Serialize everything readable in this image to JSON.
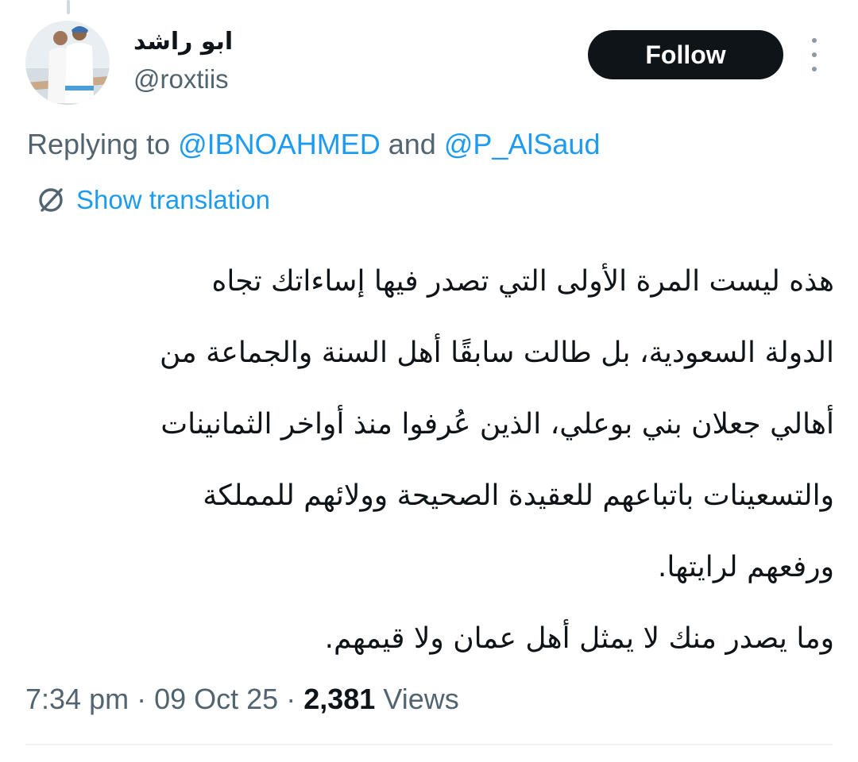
{
  "user": {
    "display_name": "ابو راشد",
    "handle": "@roxtiis"
  },
  "actions": {
    "follow_label": "Follow",
    "more_icon": "more-vertical-icon"
  },
  "reply": {
    "prefix": "Replying to",
    "mention_1": "@IBNOAHMED",
    "conjunction": "and",
    "mention_2": "@P_AlSaud"
  },
  "translation": {
    "label": "Show translation",
    "icon": "translate-icon"
  },
  "tweet": {
    "lines": [
      "هذه ليست المرة الأولى التي تصدر فيها إساءاتك تجاه",
      "الدولة السعودية، بل طالت سابقًا أهل السنة والجماعة من",
      "أهالي جعلان بني بوعلي، الذين عُرفوا منذ أواخر الثمانينات",
      "والتسعينات باتباعهم للعقيدة الصحيحة وولائهم للمملكة",
      "ورفعهم لرايتها."
    ],
    "closing_line": "وما يصدر منك لا يمثل أهل عمان ولا قيمهم."
  },
  "meta": {
    "time": "7:34 pm",
    "date": "09 Oct 25",
    "separator": "·",
    "views_count": "2,381",
    "views_label": "Views"
  },
  "colors": {
    "text_primary": "#0f1419",
    "text_secondary": "#536471",
    "link": "#1d9bf0",
    "follow_bg": "#0f1419",
    "follow_text": "#ffffff"
  }
}
